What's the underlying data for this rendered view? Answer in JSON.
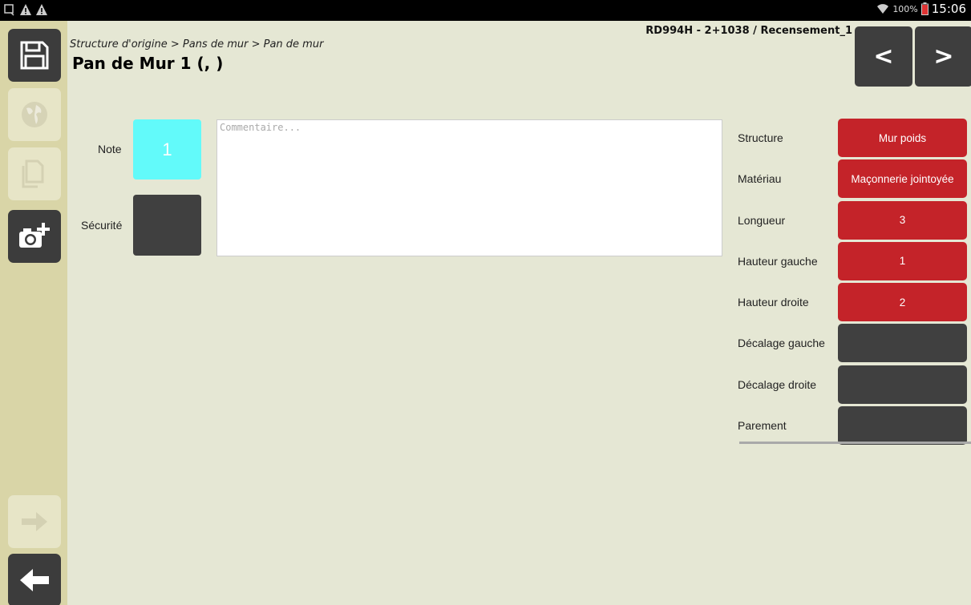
{
  "status_bar": {
    "battery_percent": "100%",
    "time": "15:06",
    "icons": [
      "screen-icon",
      "warning-icon",
      "warning-icon",
      "wifi-icon",
      "battery-icon"
    ]
  },
  "sidebar": {
    "buttons": [
      "save-icon",
      "globe-icon",
      "copy-icon",
      "add-photo-icon",
      "arrow-right-icon",
      "arrow-left-icon"
    ]
  },
  "header": {
    "breadcrumb": "Structure d'origine > Pans de mur > Pan de mur",
    "title": "Pan de Mur 1 (, )",
    "reference": "RD994H - 2+1038 / Recensement_1",
    "prev_label": "<",
    "next_label": ">"
  },
  "form": {
    "note_label": "Note",
    "note_value": "1",
    "security_label": "Sécurité",
    "comment_placeholder": "Commentaire...",
    "comment_value": ""
  },
  "properties": [
    {
      "label": "Structure",
      "value": "Mur poids"
    },
    {
      "label": "Matériau",
      "value": "Maçonnerie jointoyée"
    },
    {
      "label": "Longueur",
      "value": "3"
    },
    {
      "label": "Hauteur gauche",
      "value": "1"
    },
    {
      "label": "Hauteur droite",
      "value": "2"
    },
    {
      "label": "Décalage gauche",
      "value": ""
    },
    {
      "label": "Décalage droite",
      "value": ""
    },
    {
      "label": "Parement",
      "value": ""
    }
  ],
  "colors": {
    "background": "#e5e7d4",
    "sidebar": "#d9d5a7",
    "accent_red": "#c42329",
    "note_cyan": "#62fafa",
    "dark_button": "#3e3e3e"
  }
}
